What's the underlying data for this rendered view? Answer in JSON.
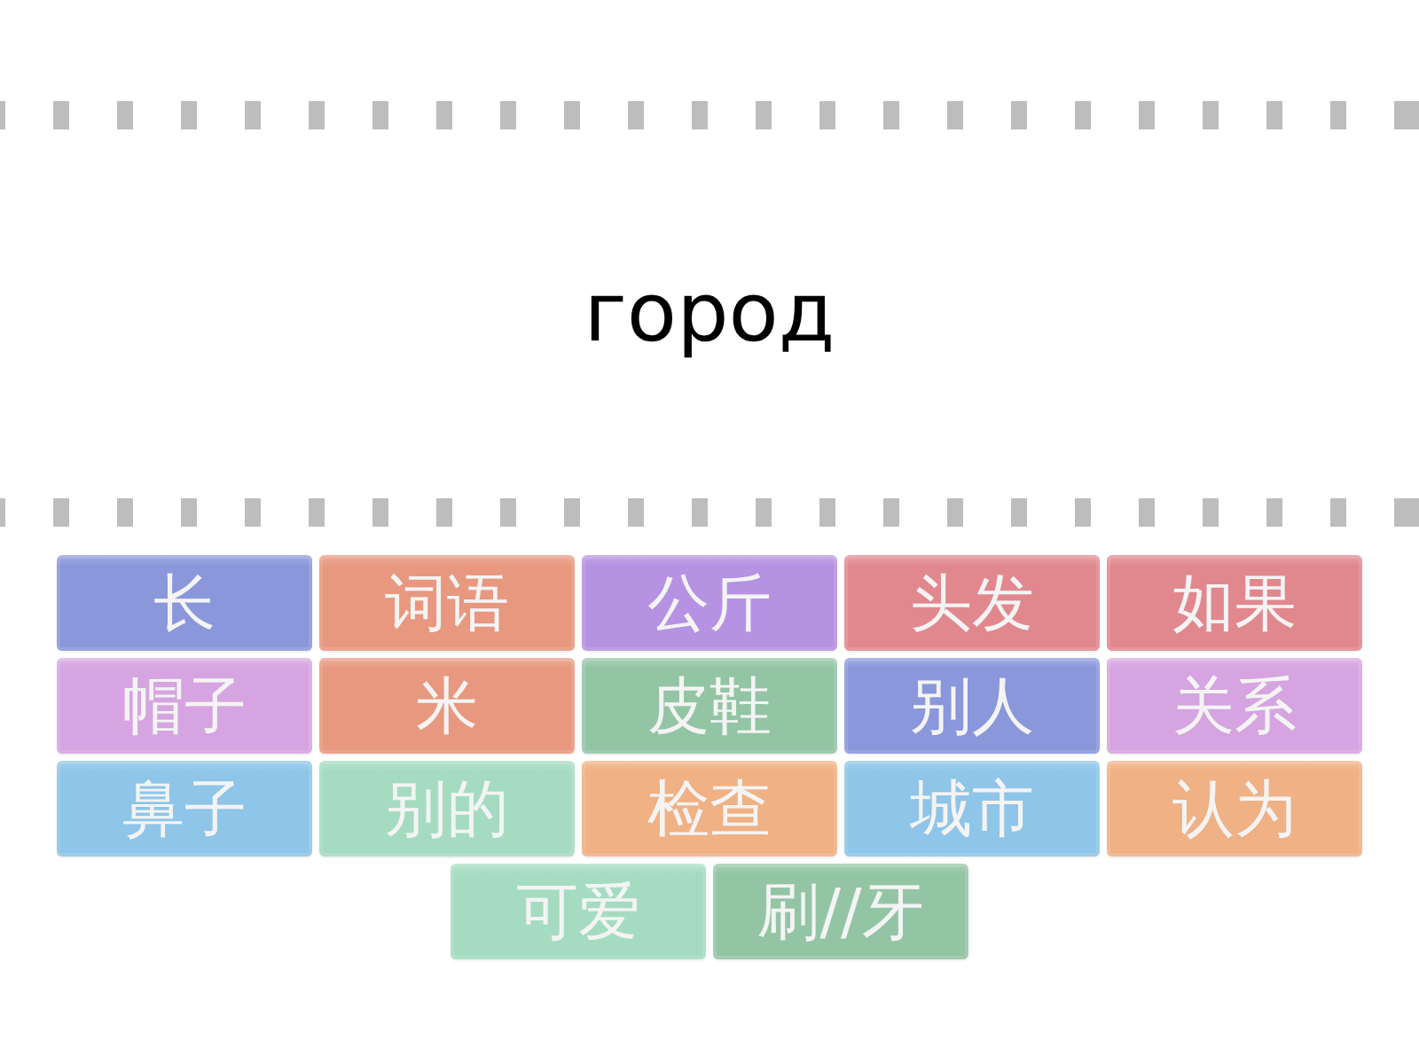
{
  "title": "город",
  "tiles": [
    {
      "label": "长",
      "color": "#8a97db"
    },
    {
      "label": "词语",
      "color": "#e8987e"
    },
    {
      "label": "公斤",
      "color": "#b592e2"
    },
    {
      "label": "头发",
      "color": "#e1888f"
    },
    {
      "label": "如果",
      "color": "#e1888f"
    },
    {
      "label": "帽子",
      "color": "#d6a4e0"
    },
    {
      "label": "米",
      "color": "#e8987e"
    },
    {
      "label": "皮鞋",
      "color": "#93c5a5"
    },
    {
      "label": "别人",
      "color": "#8a97db"
    },
    {
      "label": "关系",
      "color": "#d6a4e0"
    },
    {
      "label": "鼻子",
      "color": "#8ec5e8"
    },
    {
      "label": "别的",
      "color": "#a5dcc1"
    },
    {
      "label": "检查",
      "color": "#f0b184"
    },
    {
      "label": "城市",
      "color": "#8ec5e8"
    },
    {
      "label": "认为",
      "color": "#f0b184"
    },
    {
      "label": "可爱",
      "color": "#a5dcc1"
    },
    {
      "label": "刷//牙",
      "color": "#93c5a5"
    }
  ]
}
